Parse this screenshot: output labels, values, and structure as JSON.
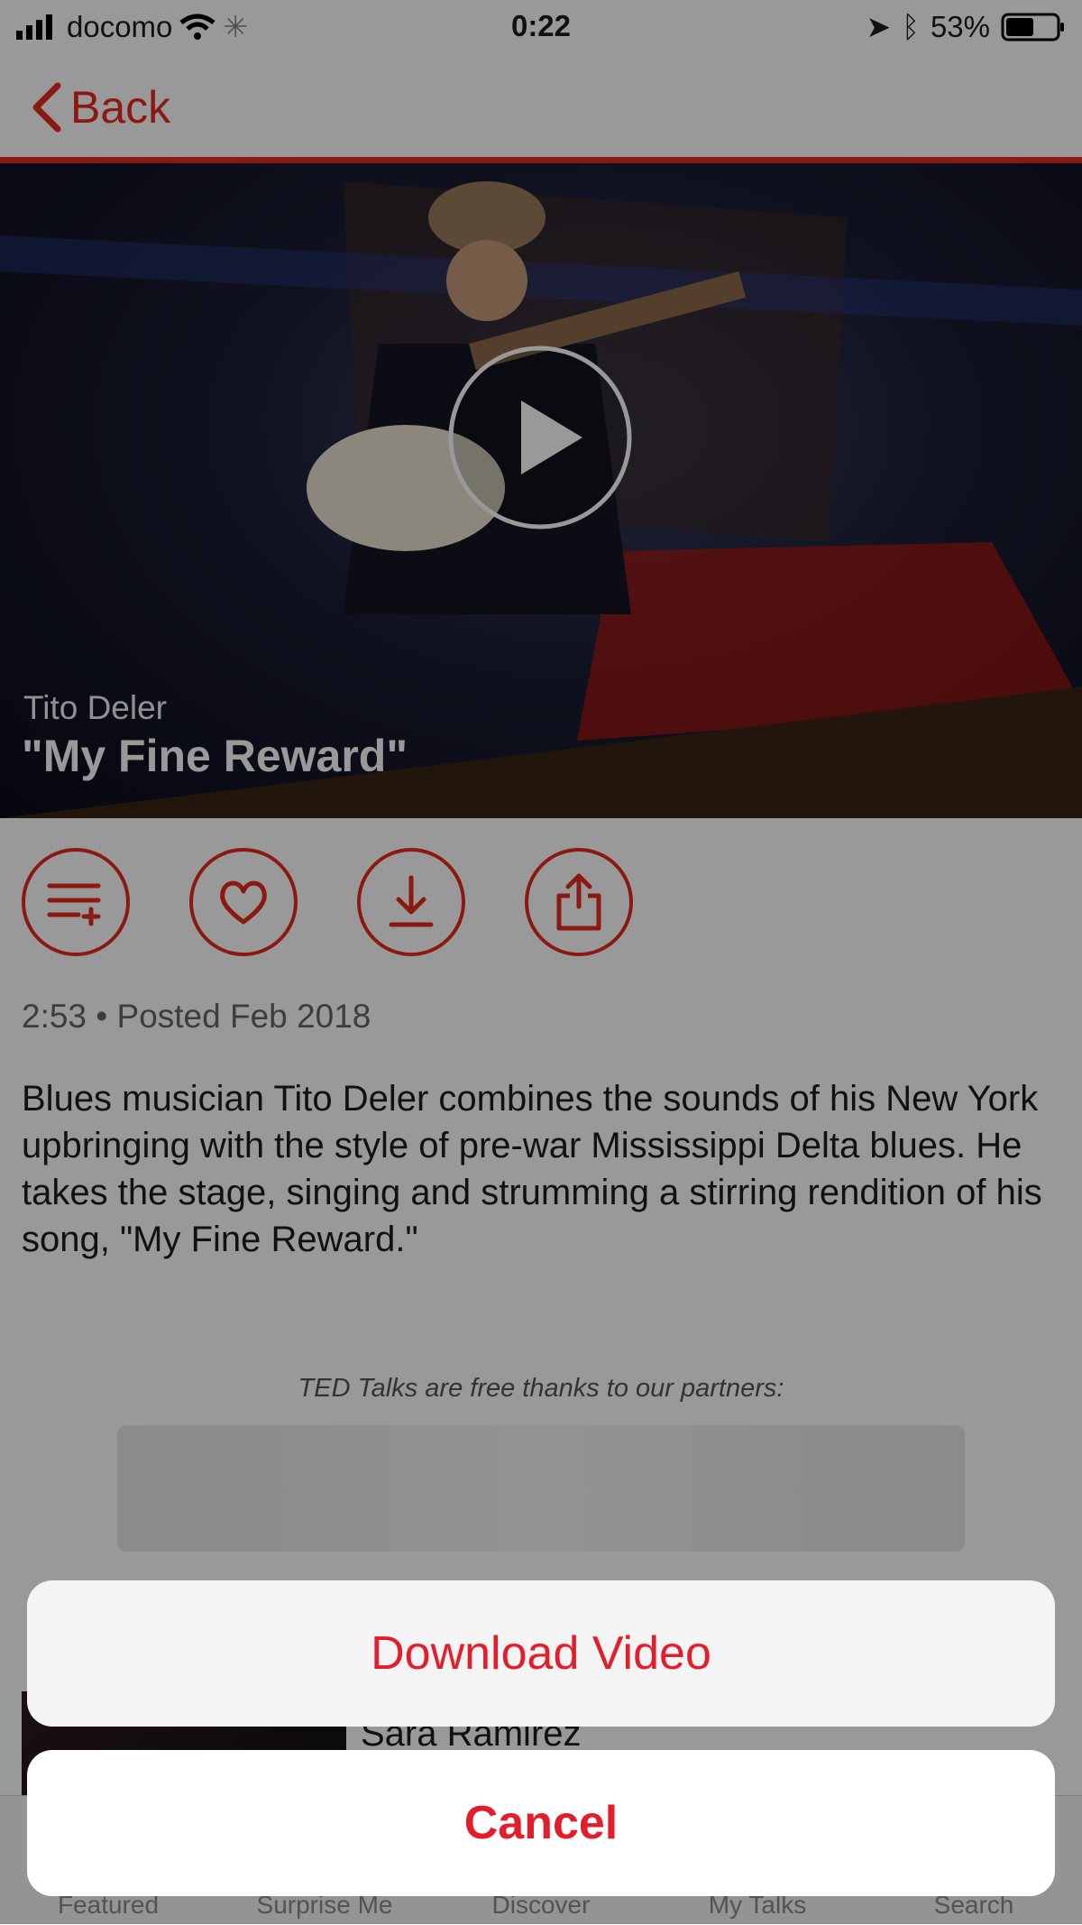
{
  "status_bar": {
    "carrier": "docomo",
    "time": "0:22",
    "battery": "53%"
  },
  "nav": {
    "back_label": "Back"
  },
  "talk": {
    "speaker": "Tito Deler",
    "title": "\"My Fine Reward\"",
    "meta": "2:53 • Posted Feb 2018",
    "description": "Blues musician Tito Deler combines the sounds of his New York upbringing with the style of pre-war Mississippi Delta blues. He takes the stage, singing and strumming a stirring rendition of his song, \"My Fine Reward.\"",
    "partners_text": "TED Talks are free thanks to our partners:"
  },
  "related": {
    "speaker": "Sara Ramirez"
  },
  "tabs": [
    "Featured",
    "Surprise Me",
    "Discover",
    "My Talks",
    "Search"
  ],
  "action_sheet": {
    "download_label": "Download Video",
    "cancel_label": "Cancel"
  },
  "colors": {
    "accent": "#e62b1e",
    "sheet_text": "#e31d2b"
  },
  "icons": [
    "signal-icon",
    "wifi-icon",
    "loading-icon",
    "location-icon",
    "bluetooth-icon",
    "battery-icon",
    "chevron-left-icon",
    "play-icon",
    "add-to-list-icon",
    "heart-icon",
    "download-icon",
    "share-icon"
  ]
}
